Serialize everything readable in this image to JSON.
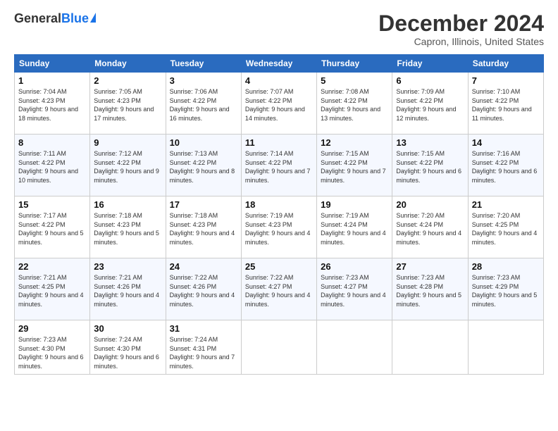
{
  "header": {
    "logo_general": "General",
    "logo_blue": "Blue",
    "month_title": "December 2024",
    "location": "Capron, Illinois, United States"
  },
  "weekdays": [
    "Sunday",
    "Monday",
    "Tuesday",
    "Wednesday",
    "Thursday",
    "Friday",
    "Saturday"
  ],
  "weeks": [
    [
      {
        "day": "1",
        "sunrise": "Sunrise: 7:04 AM",
        "sunset": "Sunset: 4:23 PM",
        "daylight": "Daylight: 9 hours and 18 minutes."
      },
      {
        "day": "2",
        "sunrise": "Sunrise: 7:05 AM",
        "sunset": "Sunset: 4:23 PM",
        "daylight": "Daylight: 9 hours and 17 minutes."
      },
      {
        "day": "3",
        "sunrise": "Sunrise: 7:06 AM",
        "sunset": "Sunset: 4:22 PM",
        "daylight": "Daylight: 9 hours and 16 minutes."
      },
      {
        "day": "4",
        "sunrise": "Sunrise: 7:07 AM",
        "sunset": "Sunset: 4:22 PM",
        "daylight": "Daylight: 9 hours and 14 minutes."
      },
      {
        "day": "5",
        "sunrise": "Sunrise: 7:08 AM",
        "sunset": "Sunset: 4:22 PM",
        "daylight": "Daylight: 9 hours and 13 minutes."
      },
      {
        "day": "6",
        "sunrise": "Sunrise: 7:09 AM",
        "sunset": "Sunset: 4:22 PM",
        "daylight": "Daylight: 9 hours and 12 minutes."
      },
      {
        "day": "7",
        "sunrise": "Sunrise: 7:10 AM",
        "sunset": "Sunset: 4:22 PM",
        "daylight": "Daylight: 9 hours and 11 minutes."
      }
    ],
    [
      {
        "day": "8",
        "sunrise": "Sunrise: 7:11 AM",
        "sunset": "Sunset: 4:22 PM",
        "daylight": "Daylight: 9 hours and 10 minutes."
      },
      {
        "day": "9",
        "sunrise": "Sunrise: 7:12 AM",
        "sunset": "Sunset: 4:22 PM",
        "daylight": "Daylight: 9 hours and 9 minutes."
      },
      {
        "day": "10",
        "sunrise": "Sunrise: 7:13 AM",
        "sunset": "Sunset: 4:22 PM",
        "daylight": "Daylight: 9 hours and 8 minutes."
      },
      {
        "day": "11",
        "sunrise": "Sunrise: 7:14 AM",
        "sunset": "Sunset: 4:22 PM",
        "daylight": "Daylight: 9 hours and 7 minutes."
      },
      {
        "day": "12",
        "sunrise": "Sunrise: 7:15 AM",
        "sunset": "Sunset: 4:22 PM",
        "daylight": "Daylight: 9 hours and 7 minutes."
      },
      {
        "day": "13",
        "sunrise": "Sunrise: 7:15 AM",
        "sunset": "Sunset: 4:22 PM",
        "daylight": "Daylight: 9 hours and 6 minutes."
      },
      {
        "day": "14",
        "sunrise": "Sunrise: 7:16 AM",
        "sunset": "Sunset: 4:22 PM",
        "daylight": "Daylight: 9 hours and 6 minutes."
      }
    ],
    [
      {
        "day": "15",
        "sunrise": "Sunrise: 7:17 AM",
        "sunset": "Sunset: 4:22 PM",
        "daylight": "Daylight: 9 hours and 5 minutes."
      },
      {
        "day": "16",
        "sunrise": "Sunrise: 7:18 AM",
        "sunset": "Sunset: 4:23 PM",
        "daylight": "Daylight: 9 hours and 5 minutes."
      },
      {
        "day": "17",
        "sunrise": "Sunrise: 7:18 AM",
        "sunset": "Sunset: 4:23 PM",
        "daylight": "Daylight: 9 hours and 4 minutes."
      },
      {
        "day": "18",
        "sunrise": "Sunrise: 7:19 AM",
        "sunset": "Sunset: 4:23 PM",
        "daylight": "Daylight: 9 hours and 4 minutes."
      },
      {
        "day": "19",
        "sunrise": "Sunrise: 7:19 AM",
        "sunset": "Sunset: 4:24 PM",
        "daylight": "Daylight: 9 hours and 4 minutes."
      },
      {
        "day": "20",
        "sunrise": "Sunrise: 7:20 AM",
        "sunset": "Sunset: 4:24 PM",
        "daylight": "Daylight: 9 hours and 4 minutes."
      },
      {
        "day": "21",
        "sunrise": "Sunrise: 7:20 AM",
        "sunset": "Sunset: 4:25 PM",
        "daylight": "Daylight: 9 hours and 4 minutes."
      }
    ],
    [
      {
        "day": "22",
        "sunrise": "Sunrise: 7:21 AM",
        "sunset": "Sunset: 4:25 PM",
        "daylight": "Daylight: 9 hours and 4 minutes."
      },
      {
        "day": "23",
        "sunrise": "Sunrise: 7:21 AM",
        "sunset": "Sunset: 4:26 PM",
        "daylight": "Daylight: 9 hours and 4 minutes."
      },
      {
        "day": "24",
        "sunrise": "Sunrise: 7:22 AM",
        "sunset": "Sunset: 4:26 PM",
        "daylight": "Daylight: 9 hours and 4 minutes."
      },
      {
        "day": "25",
        "sunrise": "Sunrise: 7:22 AM",
        "sunset": "Sunset: 4:27 PM",
        "daylight": "Daylight: 9 hours and 4 minutes."
      },
      {
        "day": "26",
        "sunrise": "Sunrise: 7:23 AM",
        "sunset": "Sunset: 4:27 PM",
        "daylight": "Daylight: 9 hours and 4 minutes."
      },
      {
        "day": "27",
        "sunrise": "Sunrise: 7:23 AM",
        "sunset": "Sunset: 4:28 PM",
        "daylight": "Daylight: 9 hours and 5 minutes."
      },
      {
        "day": "28",
        "sunrise": "Sunrise: 7:23 AM",
        "sunset": "Sunset: 4:29 PM",
        "daylight": "Daylight: 9 hours and 5 minutes."
      }
    ],
    [
      {
        "day": "29",
        "sunrise": "Sunrise: 7:23 AM",
        "sunset": "Sunset: 4:30 PM",
        "daylight": "Daylight: 9 hours and 6 minutes."
      },
      {
        "day": "30",
        "sunrise": "Sunrise: 7:24 AM",
        "sunset": "Sunset: 4:30 PM",
        "daylight": "Daylight: 9 hours and 6 minutes."
      },
      {
        "day": "31",
        "sunrise": "Sunrise: 7:24 AM",
        "sunset": "Sunset: 4:31 PM",
        "daylight": "Daylight: 9 hours and 7 minutes."
      },
      null,
      null,
      null,
      null
    ]
  ]
}
